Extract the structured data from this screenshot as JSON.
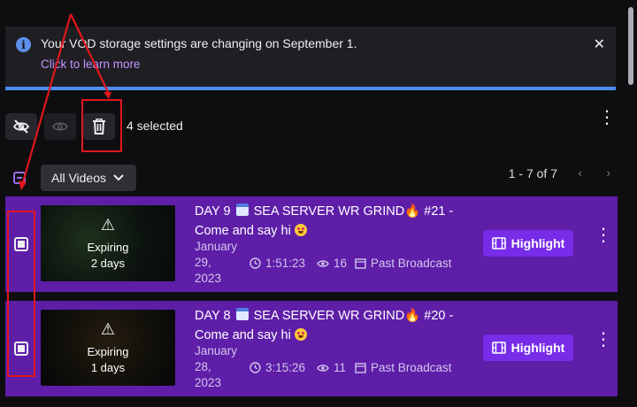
{
  "banner": {
    "message": "Your VOD storage settings are changing on September 1.",
    "link": "Click to learn more",
    "close": "✕"
  },
  "toolbar": {
    "selected_count": "4 selected"
  },
  "filter": {
    "dropdown_label": "All Videos",
    "pagination": "1 - 7 of 7",
    "prev": "‹",
    "next": "›"
  },
  "videos": [
    {
      "title_prefix": "DAY 9",
      "title_main": "SEA SERVER WR GRIND",
      "title_suffix": "#21 -",
      "title_line2": "Come and say hi",
      "expiring_label": "Expiring",
      "expiring_days": "2 days",
      "date_line1": "January",
      "date_line2": "29,",
      "date_line3": "2023",
      "duration": "1:51:23",
      "views": "16",
      "type": "Past Broadcast",
      "highlight_label": "Highlight"
    },
    {
      "title_prefix": "DAY 8",
      "title_main": "SEA SERVER WR GRIND",
      "title_suffix": "#20 -",
      "title_line2": "Come and say hi",
      "expiring_label": "Expiring",
      "expiring_days": "1 days",
      "date_line1": "January",
      "date_line2": "28,",
      "date_line3": "2023",
      "duration": "3:15:26",
      "views": "11",
      "type": "Past Broadcast",
      "highlight_label": "Highlight"
    }
  ],
  "colors": {
    "row_selected": "#5e1ea8",
    "accent": "#772ce8",
    "link": "#bf94ff",
    "annotation": "#e0171d"
  }
}
